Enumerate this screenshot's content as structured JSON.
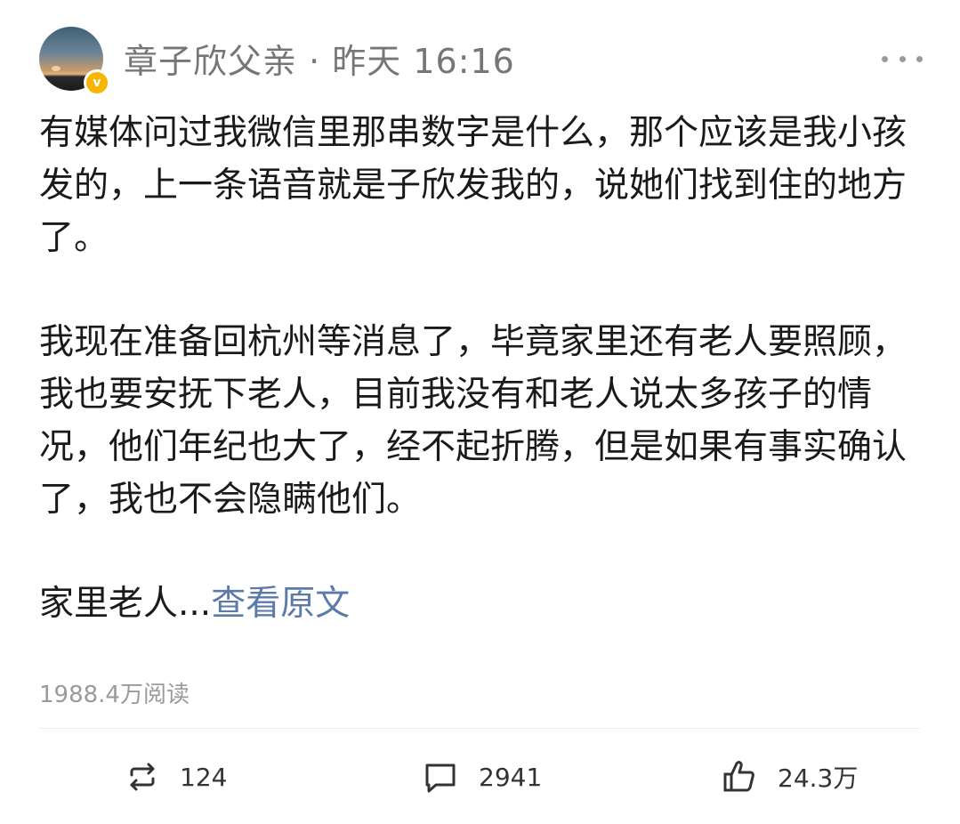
{
  "post": {
    "author": "章子欣父亲",
    "separator": " · ",
    "time": "昨天 16:16",
    "verified_badge": "v",
    "paragraphs": [
      "有媒体问过我微信里那串数字是什么，那个应该是我小孩发的，上一条语音就是子欣发我的，说她们找到住的地方了。",
      "我现在准备回杭州等消息了，毕竟家里还有老人要照顾，我也要安抚下老人，目前我没有和老人说太多孩子的情况，他们年纪也大了，经不起折腾，但是如果有事实确认了，我也不会隐瞒他们。"
    ],
    "truncated_text": "家里老人...",
    "read_more_label": "查看原文",
    "read_count": "1988.4万阅读"
  },
  "actions": {
    "repost_count": "124",
    "comment_count": "2941",
    "like_count": "24.3万"
  },
  "icons": {
    "more": "more-horizontal-icon",
    "repost": "repost-icon",
    "comment": "comment-icon",
    "like": "thumbs-up-icon"
  },
  "colors": {
    "link": "#5b7aa8",
    "muted": "#9a9a9a",
    "badge": "#f7b500"
  }
}
